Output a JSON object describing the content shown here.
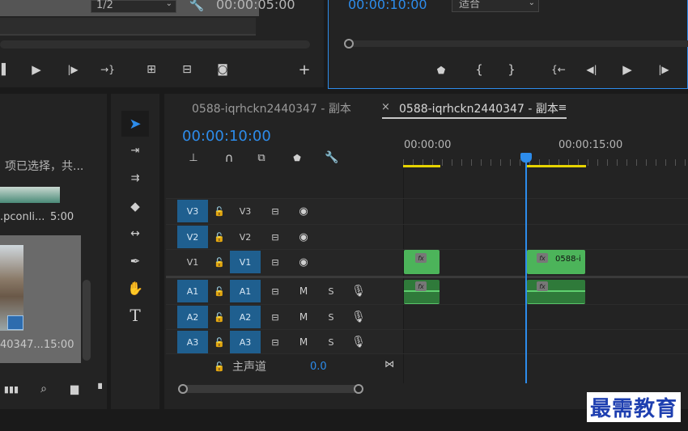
{
  "source_monitor": {
    "resolution": "1/2",
    "timecode": "00:00:05:00"
  },
  "program_monitor": {
    "timecode": "00:00:10:00",
    "fit": "适合"
  },
  "project": {
    "selection_text": "项已选择，共...",
    "item1_name": ".pconli...",
    "item1_duration": "5:00",
    "item2_name": "40347...",
    "item2_duration": "15:00"
  },
  "timeline": {
    "tabs": [
      {
        "label": "0588-iqrhckn2440347 - 副本"
      },
      {
        "label": "0588-iqrhckn2440347 - 副本"
      }
    ],
    "tab_close": "×",
    "timecode": "00:00:10:00",
    "ruler": [
      "00:00:00",
      "00:00:15:00"
    ],
    "video_tracks": [
      {
        "src": "V3",
        "name": "V3"
      },
      {
        "src": "V2",
        "name": "V2"
      },
      {
        "src": "V1",
        "name": "V1"
      }
    ],
    "audio_tracks": [
      {
        "src": "A1",
        "name": "A1",
        "m": "M",
        "s": "S"
      },
      {
        "src": "A2",
        "name": "A2",
        "m": "M",
        "s": "S"
      },
      {
        "src": "A3",
        "name": "A3",
        "m": "M",
        "s": "S"
      }
    ],
    "master": {
      "label": "主声道",
      "value": "0.0"
    },
    "clip_label": "0588-i",
    "fx": "fx"
  },
  "watermark": "最需教育",
  "colors": {
    "accent": "#2d8ceb",
    "video_clip": "#4cb45a",
    "audio_clip": "#2f7a3a",
    "track_on": "#1f5f8f"
  }
}
